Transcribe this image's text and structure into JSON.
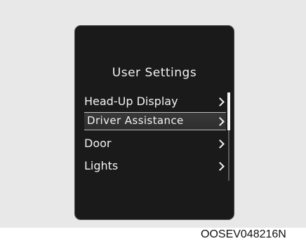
{
  "screen": {
    "title": "User Settings",
    "menu": [
      {
        "label": "Head-Up Display",
        "icon": "chevron-right-icon"
      },
      {
        "label": "Driver Assistance",
        "icon": "chevron-right-icon",
        "selected": true
      },
      {
        "label": "Door",
        "icon": "chevron-right-icon"
      },
      {
        "label": "Lights",
        "icon": "chevron-right-icon"
      }
    ]
  },
  "caption": "OOSEV048216N",
  "colors": {
    "screen_background": "#1b1a1a",
    "text": "#f2f2f2",
    "selection_border": "#bdbdbd",
    "page_background": "#e8e8e8"
  }
}
